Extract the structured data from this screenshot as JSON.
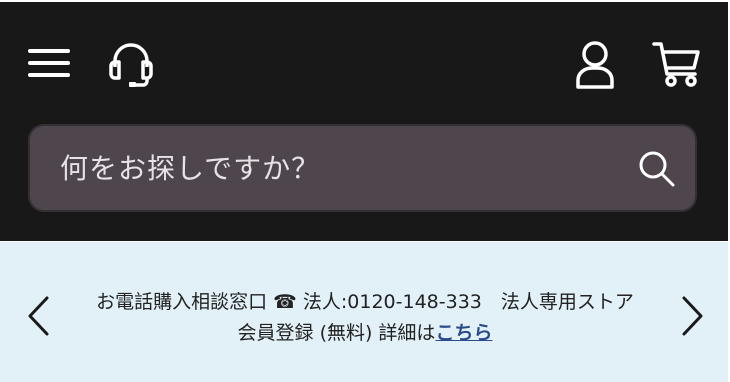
{
  "header": {
    "menu_icon": "hamburger-menu-icon",
    "support_icon": "headset-icon",
    "account_icon": "user-icon",
    "cart_icon": "shopping-cart-icon",
    "search": {
      "placeholder": "何をお探しですか？",
      "icon": "search-icon"
    }
  },
  "banner": {
    "prev_icon": "chevron-left-icon",
    "next_icon": "chevron-right-icon",
    "text_line1": "お電話購入相談窓口 ☎ 法人:0120-148-333　法人専用ストア",
    "text_line2_prefix": "会員登録 (無料) 詳細は",
    "link_text": "こちら"
  },
  "colors": {
    "header_bg": "#191818",
    "search_bg": "#4e454d",
    "banner_bg": "#e2f1f8",
    "link": "#2a4a8a"
  }
}
